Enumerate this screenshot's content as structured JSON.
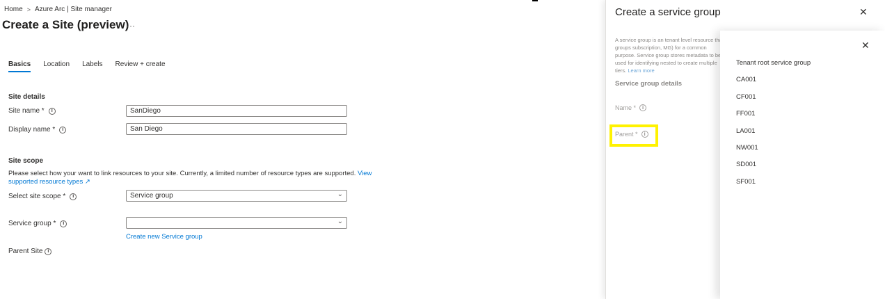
{
  "breadcrumb": {
    "home": "Home",
    "separator": ">",
    "current": "Azure Arc | Site manager"
  },
  "page": {
    "title": "Create a Site (preview)",
    "more": "···"
  },
  "tabs": [
    {
      "label": "Basics"
    },
    {
      "label": "Location"
    },
    {
      "label": "Labels"
    },
    {
      "label": "Review + create"
    }
  ],
  "site_details": {
    "heading": "Site details",
    "site_name_label": "Site name *",
    "site_name_value": "SanDiego",
    "display_name_label": "Display name *",
    "display_name_value": "San Diego"
  },
  "site_scope": {
    "heading": "Site scope",
    "description": "Please select how your want to link resources to your site. Currently, a limited number of resource types are supported.",
    "view_link": "View supported resource types",
    "external_icon": "↗",
    "scope_label": "Select site scope *",
    "scope_value": "Service group",
    "service_group_label": "Service group *",
    "service_group_value": "",
    "create_link": "Create new Service group",
    "parent_site_label": "Parent Site"
  },
  "panel": {
    "title": "Create a service group",
    "close": "✕",
    "description": "A service group is an tenant level resource that groups subscription, MG) for a common purpose. Service group stores metadata to be used for identifying nested to create multiple tiers.",
    "learn_more": "Learn more",
    "section": "Service group details",
    "name_label": "Name *",
    "parent_label": "Parent *"
  },
  "dropdown": {
    "close": "✕",
    "items": [
      "Tenant root service group",
      "CA001",
      "CF001",
      "FF001",
      "LA001",
      "NW001",
      "SD001",
      "SF001"
    ]
  },
  "icons": {
    "info": "i",
    "chevron": "⌄"
  },
  "colors": {
    "accent": "#0078d4",
    "highlight": "#fff200"
  }
}
